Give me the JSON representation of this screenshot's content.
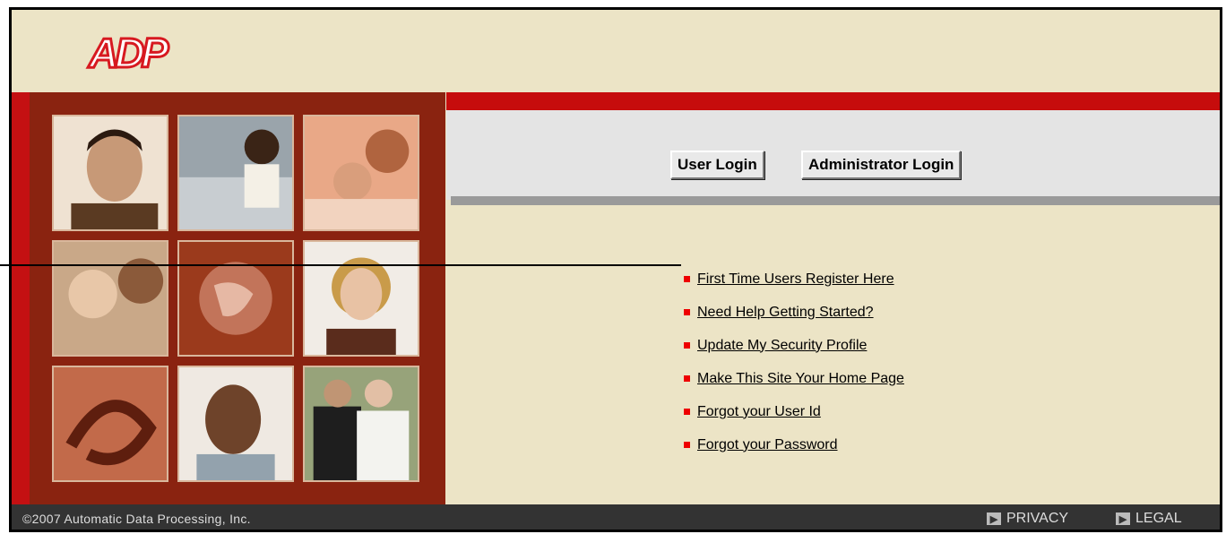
{
  "brand": {
    "logo_text": "ADP",
    "logo_color": "#D71920"
  },
  "login": {
    "user_label": "User Login",
    "admin_label": "Administrator Login"
  },
  "links": [
    "First Time Users Register Here",
    "Need Help Getting Started?",
    "Update My Security Profile",
    "Make This Site Your Home Page",
    "Forgot your User Id",
    "Forgot your Password"
  ],
  "footer": {
    "copyright": "©2007 Automatic Data Processing, Inc.",
    "privacy": "PRIVACY",
    "legal": "LEGAL"
  },
  "colors": {
    "accent_red": "#C60C0C",
    "panel_brown": "#8A2310",
    "background": "#ECE4C6"
  }
}
